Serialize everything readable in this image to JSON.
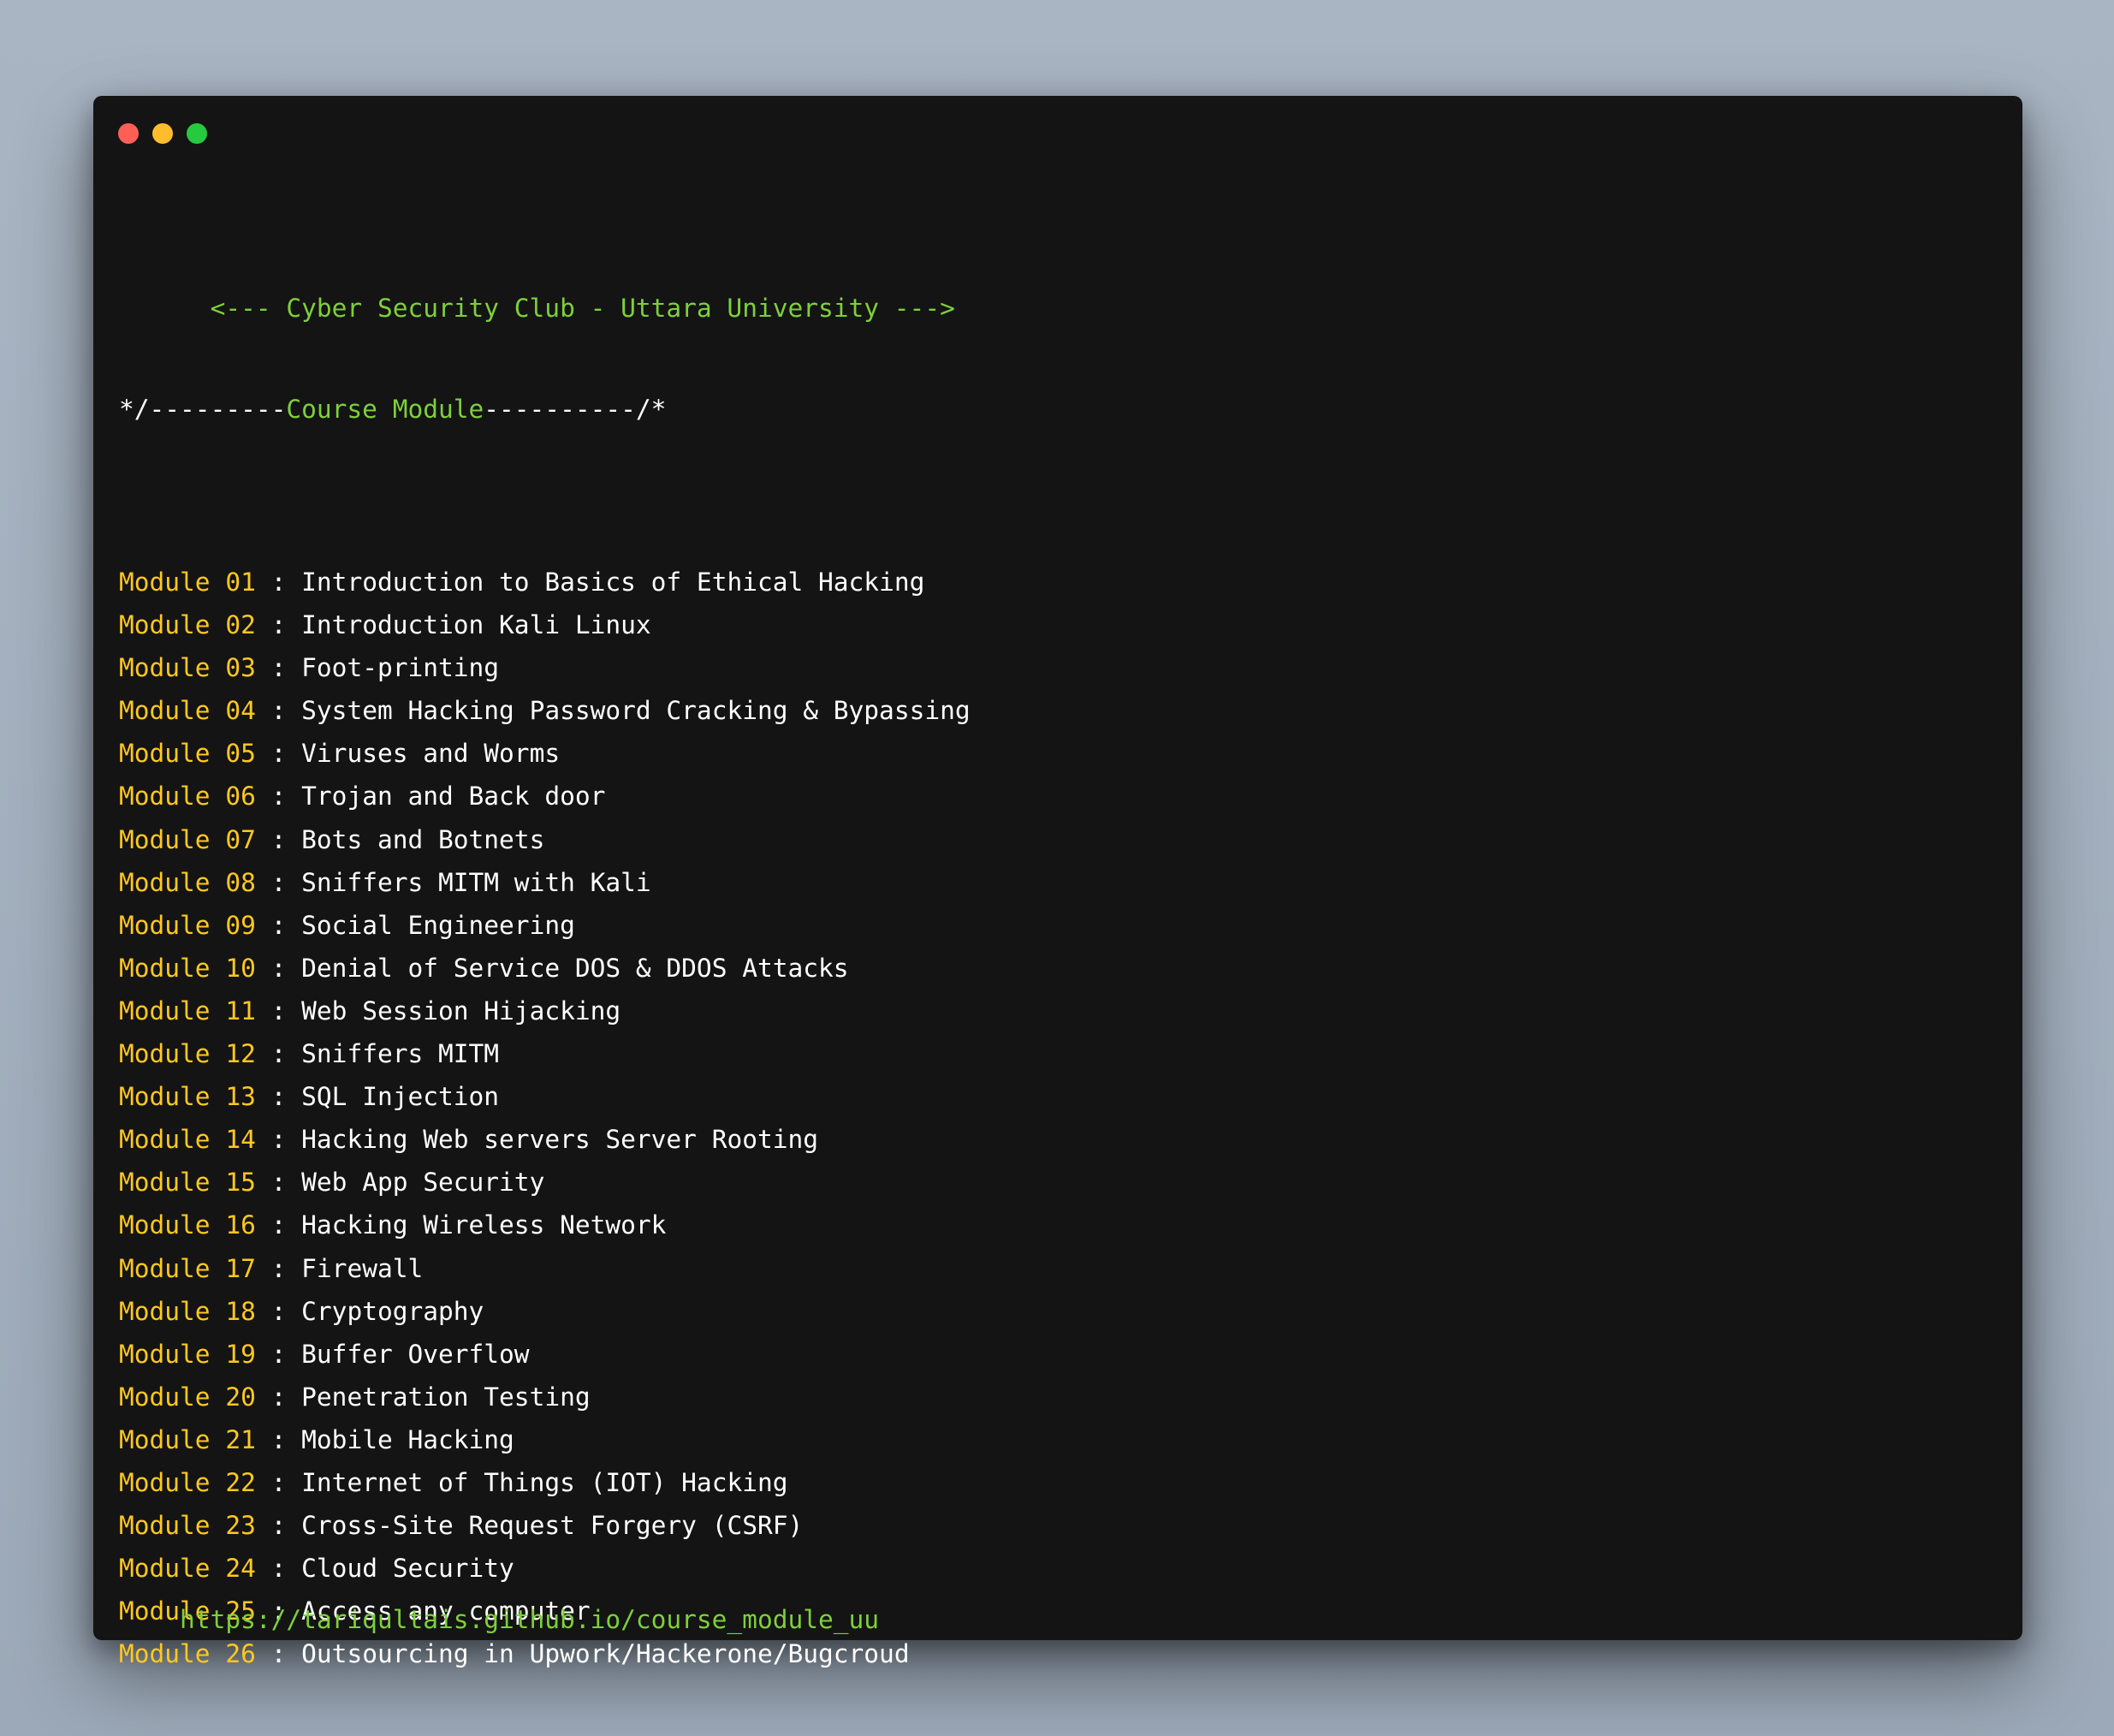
{
  "window": {
    "controls": [
      "close",
      "minimize",
      "maximize"
    ]
  },
  "header": {
    "text": "<--- Cyber Security Club - Uttara University --->"
  },
  "section": {
    "prefix": "*/---------",
    "title": "Course Module",
    "suffix": "----------/*"
  },
  "modules": [
    {
      "label": "Module 01",
      "sep": " : ",
      "title": "Introduction to Basics of Ethical Hacking"
    },
    {
      "label": "Module 02",
      "sep": " : ",
      "title": "Introduction Kali Linux"
    },
    {
      "label": "Module 03",
      "sep": " : ",
      "title": "Foot-printing"
    },
    {
      "label": "Module 04",
      "sep": " : ",
      "title": "System Hacking Password Cracking & Bypassing"
    },
    {
      "label": "Module 05",
      "sep": " : ",
      "title": "Viruses and Worms"
    },
    {
      "label": "Module 06",
      "sep": " : ",
      "title": "Trojan and Back door"
    },
    {
      "label": "Module 07",
      "sep": " : ",
      "title": "Bots and Botnets"
    },
    {
      "label": "Module 08",
      "sep": " : ",
      "title": "Sniffers MITM with Kali"
    },
    {
      "label": "Module 09",
      "sep": " : ",
      "title": "Social Engineering"
    },
    {
      "label": "Module 10",
      "sep": " : ",
      "title": "Denial of Service DOS & DDOS Attacks"
    },
    {
      "label": "Module 11",
      "sep": " : ",
      "title": "Web Session Hijacking"
    },
    {
      "label": "Module 12",
      "sep": " : ",
      "title": "Sniffers MITM"
    },
    {
      "label": "Module 13",
      "sep": " : ",
      "title": "SQL Injection"
    },
    {
      "label": "Module 14",
      "sep": " : ",
      "title": "Hacking Web servers Server Rooting"
    },
    {
      "label": "Module 15",
      "sep": " : ",
      "title": "Web App Security"
    },
    {
      "label": "Module 16",
      "sep": " : ",
      "title": "Hacking Wireless Network"
    },
    {
      "label": "Module 17",
      "sep": " : ",
      "title": "Firewall"
    },
    {
      "label": "Module 18",
      "sep": " : ",
      "title": "Cryptography"
    },
    {
      "label": "Module 19",
      "sep": " : ",
      "title": "Buffer Overflow"
    },
    {
      "label": "Module 20",
      "sep": " : ",
      "title": "Penetration Testing"
    },
    {
      "label": "Module 21",
      "sep": " : ",
      "title": "Mobile Hacking"
    },
    {
      "label": "Module 22",
      "sep": " : ",
      "title": "Internet of Things (IOT) Hacking"
    },
    {
      "label": "Module 23",
      "sep": " : ",
      "title": "Cross-Site Request Forgery (CSRF)"
    },
    {
      "label": "Module 24",
      "sep": " : ",
      "title": "Cloud Security"
    },
    {
      "label": "Module 25",
      "sep": " : ",
      "title": "Access any computer"
    },
    {
      "label": "Module 26",
      "sep": " : ",
      "title": "Outsourcing in Upwork/Hackerone/Bugcroud"
    }
  ],
  "footer": {
    "url": "https://tariqultais.github.io/course_module_uu"
  },
  "colors": {
    "background": "#a9b5c3",
    "window": "#141414",
    "green": "#7ed03a",
    "yellow": "#ffc81f",
    "white": "#ffffff",
    "close": "#ff5f56",
    "minimize": "#ffbd2e",
    "maximize": "#27c93f"
  }
}
